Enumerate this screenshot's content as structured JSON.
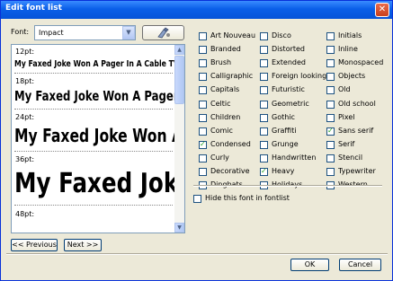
{
  "window": {
    "title": "Edit font list"
  },
  "font_label": "Font:",
  "font_select": {
    "value": "Impact"
  },
  "preview": {
    "sample_text": "My Faxed Joke Won A Pager In A Cable TV",
    "sizes": [
      "12pt:",
      "18pt:",
      "24pt:",
      "36pt:",
      "48pt:"
    ]
  },
  "nav": {
    "previous": "<< Previous",
    "next": "Next >>"
  },
  "categories": [
    {
      "label": "Art Nouveau",
      "checked": false
    },
    {
      "label": "Branded",
      "checked": false
    },
    {
      "label": "Brush",
      "checked": false
    },
    {
      "label": "Calligraphic",
      "checked": false
    },
    {
      "label": "Capitals",
      "checked": false
    },
    {
      "label": "Celtic",
      "checked": false
    },
    {
      "label": "Children",
      "checked": false
    },
    {
      "label": "Comic",
      "checked": false
    },
    {
      "label": "Condensed",
      "checked": true
    },
    {
      "label": "Curly",
      "checked": false
    },
    {
      "label": "Decorative",
      "checked": false
    },
    {
      "label": "Dingbats",
      "checked": false
    },
    {
      "label": "Disco",
      "checked": false
    },
    {
      "label": "Distorted",
      "checked": false
    },
    {
      "label": "Extended",
      "checked": false
    },
    {
      "label": "Foreign looking",
      "checked": false
    },
    {
      "label": "Futuristic",
      "checked": false
    },
    {
      "label": "Geometric",
      "checked": false
    },
    {
      "label": "Gothic",
      "checked": false
    },
    {
      "label": "Graffiti",
      "checked": false
    },
    {
      "label": "Grunge",
      "checked": false
    },
    {
      "label": "Handwritten",
      "checked": false
    },
    {
      "label": "Heavy",
      "checked": true
    },
    {
      "label": "Holidays",
      "checked": false
    },
    {
      "label": "Initials",
      "checked": false
    },
    {
      "label": "Inline",
      "checked": false
    },
    {
      "label": "Monospaced",
      "checked": false
    },
    {
      "label": "Objects",
      "checked": false
    },
    {
      "label": "Old",
      "checked": false
    },
    {
      "label": "Old school",
      "checked": false
    },
    {
      "label": "Pixel",
      "checked": false
    },
    {
      "label": "Sans serif",
      "checked": true
    },
    {
      "label": "Serif",
      "checked": false
    },
    {
      "label": "Stencil",
      "checked": false
    },
    {
      "label": "Typewriter",
      "checked": false
    },
    {
      "label": "Western",
      "checked": false
    }
  ],
  "hide_option": {
    "label": "Hide this font in fontlist",
    "checked": false
  },
  "buttons": {
    "ok": "OK",
    "cancel": "Cancel"
  }
}
